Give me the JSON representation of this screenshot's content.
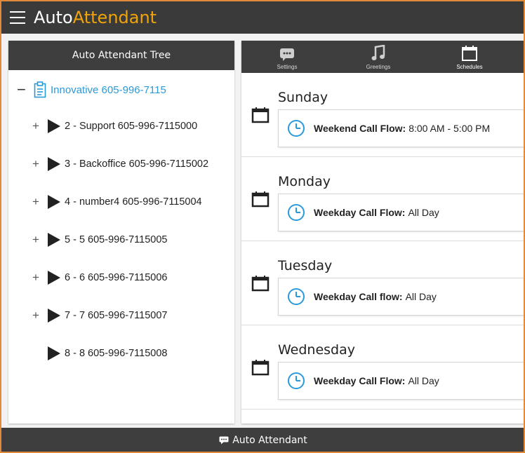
{
  "app": {
    "title_part1": "Auto",
    "title_part2": "Attendant",
    "accent_color": "#f0a30a",
    "header_bg": "#3a3a3a"
  },
  "tree": {
    "header": "Auto Attendant Tree",
    "root": {
      "collapse_symbol": "−",
      "label": "Innovative 605-996-7115",
      "icon": "clipboard-icon"
    },
    "items": [
      {
        "expand": "+",
        "label": "2 - Support 605-996-7115000"
      },
      {
        "expand": "+",
        "label": "3 - Backoffice 605-996-7115002"
      },
      {
        "expand": "+",
        "label": "4 - number4 605-996-7115004"
      },
      {
        "expand": "+",
        "label": "5 - 5 605-996-7115005"
      },
      {
        "expand": "+",
        "label": "6 - 6 605-996-7115006"
      },
      {
        "expand": "+",
        "label": "7 - 7 605-996-7115007"
      },
      {
        "expand": "",
        "label": "8 - 8 605-996-7115008"
      }
    ]
  },
  "tabs": [
    {
      "label": "Settings",
      "icon": "chat-bubble-icon"
    },
    {
      "label": "Greetings",
      "icon": "music-note-icon"
    },
    {
      "label": "Schedules",
      "icon": "calendar-icon",
      "active": true
    }
  ],
  "schedule": [
    {
      "day": "Sunday",
      "flow_label": "Weekend Call Flow:",
      "flow_value": "8:00 AM - 5:00 PM"
    },
    {
      "day": "Monday",
      "flow_label": "Weekday Call Flow:",
      "flow_value": "All Day"
    },
    {
      "day": "Tuesday",
      "flow_label": "Weekday Call flow:",
      "flow_value": "All Day"
    },
    {
      "day": "Wednesday",
      "flow_label": "Weekday Call Flow:",
      "flow_value": "All Day"
    }
  ],
  "footer": {
    "label": "Auto Attendant",
    "icon": "chat-icon"
  },
  "colors": {
    "link_blue": "#2b9ad8",
    "clock_blue": "#2b9ad8",
    "frame_border": "#e08a3c"
  }
}
